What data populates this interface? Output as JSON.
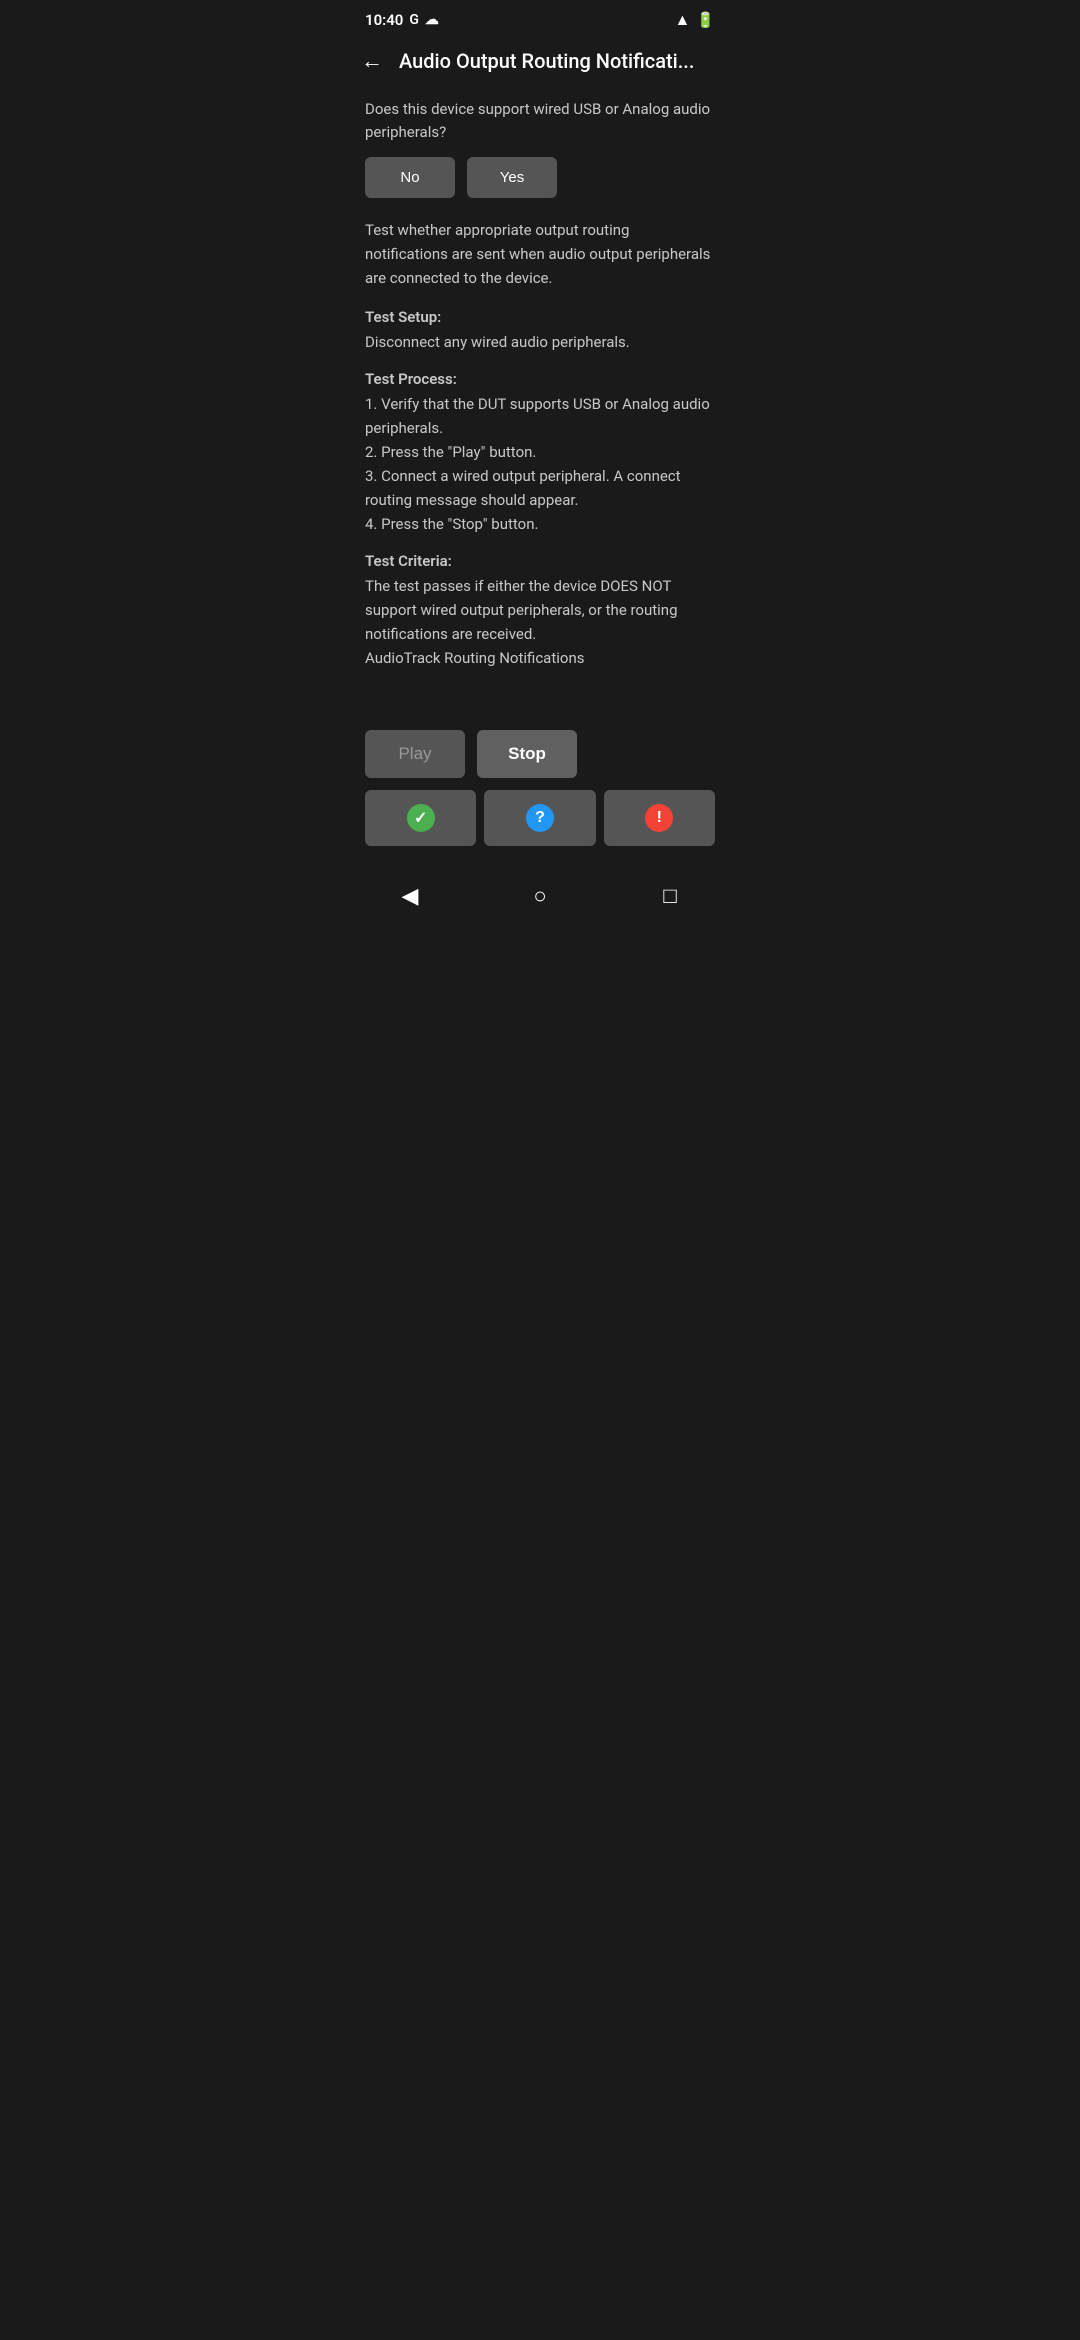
{
  "status_bar": {
    "time": "10:40",
    "network_type": "G",
    "cloud_label": "cloud"
  },
  "header": {
    "back_label": "←",
    "title": "Audio Output Routing Notificati..."
  },
  "main": {
    "question": "Does this device support wired USB or Analog audio peripherals?",
    "btn_no": "No",
    "btn_yes": "Yes",
    "description": "Test whether appropriate output routing notifications are sent when audio output peripherals are connected to the device.",
    "test_setup_title": "Test Setup:",
    "test_setup_content": "Disconnect any wired audio peripherals.",
    "test_process_title": "Test Process:",
    "test_process_content": "1. Verify that the DUT supports USB or Analog audio peripherals.\n2. Press the \"Play\" button.\n3. Connect a wired output peripheral. A connect routing message should appear.\n4. Press the \"Stop\" button.",
    "test_criteria_title": "Test Criteria:",
    "test_criteria_content": "The test passes if either the device DOES NOT support wired output peripherals, or the routing notifications are received.\nAudioTrack Routing Notifications",
    "btn_play": "Play",
    "btn_stop": "Stop",
    "btn_pass_icon": "✓",
    "btn_info_icon": "?",
    "btn_fail_icon": "!"
  },
  "nav": {
    "back_icon": "◀",
    "home_icon": "○",
    "recent_icon": "□"
  }
}
